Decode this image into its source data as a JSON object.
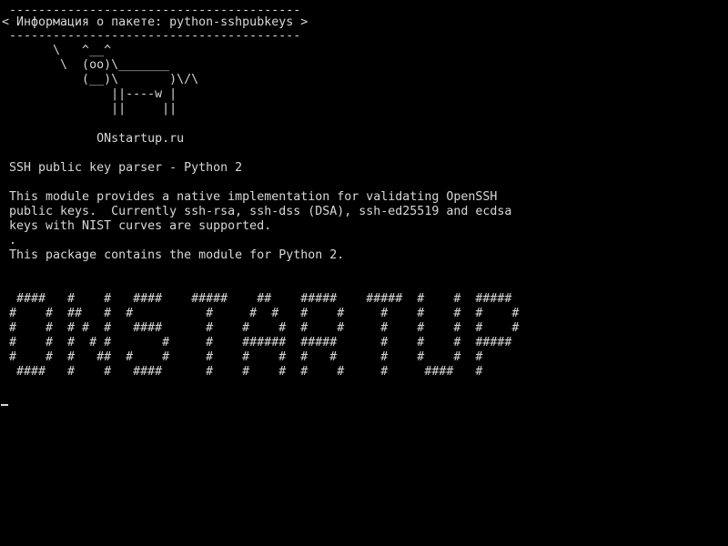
{
  "terminal": {
    "header": {
      "top_rule": " ----------------------------------------",
      "title": "< Информация о пакете: python-sshpubkeys >",
      "bottom_rule": " ----------------------------------------"
    },
    "cowsay": [
      "       \\   ^__^",
      "        \\  (oo)\\_______",
      "           (__)\\       )\\/\\",
      "               ||----w |",
      "               ||     ||"
    ],
    "site": "             ONstartup.ru",
    "summary": " SSH public key parser - Python 2",
    "description": [
      " This module provides a native implementation for validating OpenSSH",
      " public keys.  Currently ssh-rsa, ssh-dss (DSA), ssh-ed25519 and ecdsa",
      " keys with NIST curves are supported.",
      " .",
      " This package contains the module for Python 2."
    ],
    "banner": [
      "  ####   #    #   ####    #####    ##    #####    #####  #    #  #####",
      " #    #  ##   #  #          #     #  #   #    #     #    #    #  #    #",
      " #    #  # #  #   ####      #    #    #  #    #     #    #    #  #    #",
      " #    #  #  # #       #     #    ######  #####      #    #    #  #####",
      " #    #  #   ##  #    #     #    #    #  #   #      #    #    #  #",
      "  ####   #    #   ####      #    #    #  #    #     #     ####   #"
    ]
  }
}
